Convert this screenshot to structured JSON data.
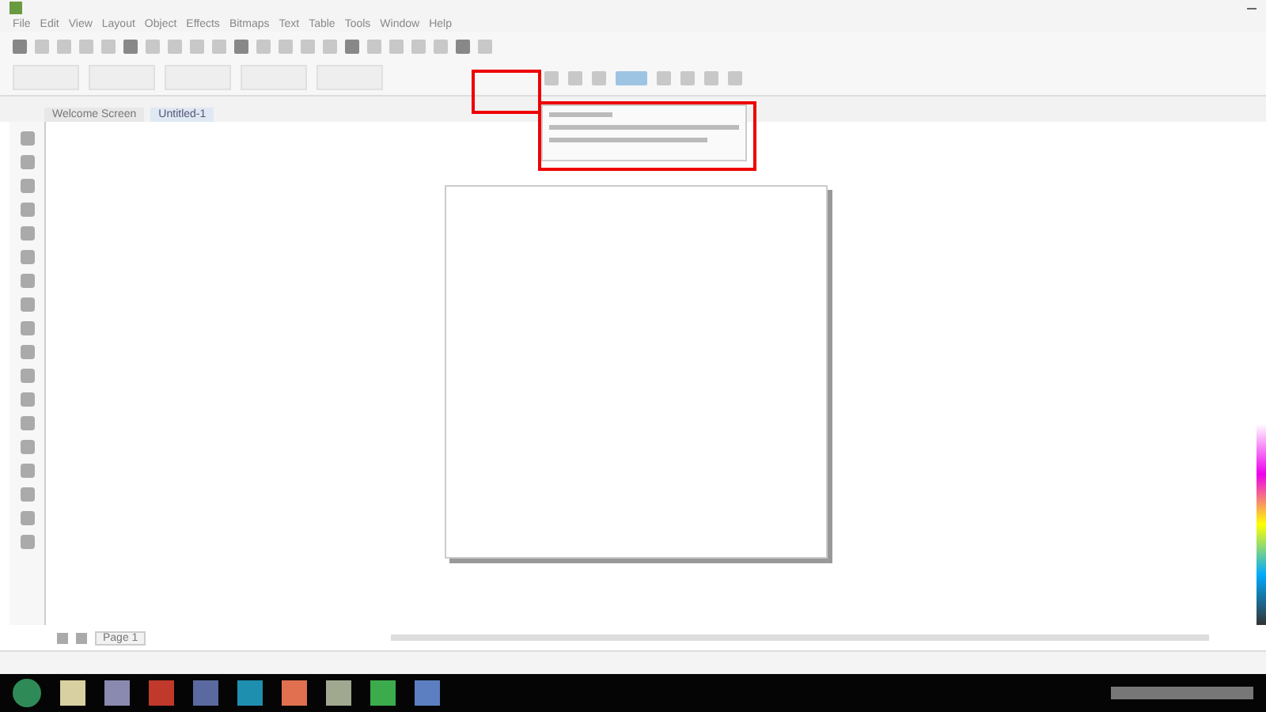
{
  "menu": [
    "File",
    "Edit",
    "View",
    "Layout",
    "Object",
    "Effects",
    "Bitmaps",
    "Text",
    "Table",
    "Tools",
    "Window",
    "Help"
  ],
  "document_tabs": [
    {
      "label": "Welcome Screen",
      "selected": false
    },
    {
      "label": "Untitled-1",
      "selected": true
    }
  ],
  "page_tabs": [
    {
      "label": "Page 1",
      "selected": true
    }
  ],
  "highlights": [
    {
      "kind": "frame"
    },
    {
      "kind": "frame"
    }
  ]
}
